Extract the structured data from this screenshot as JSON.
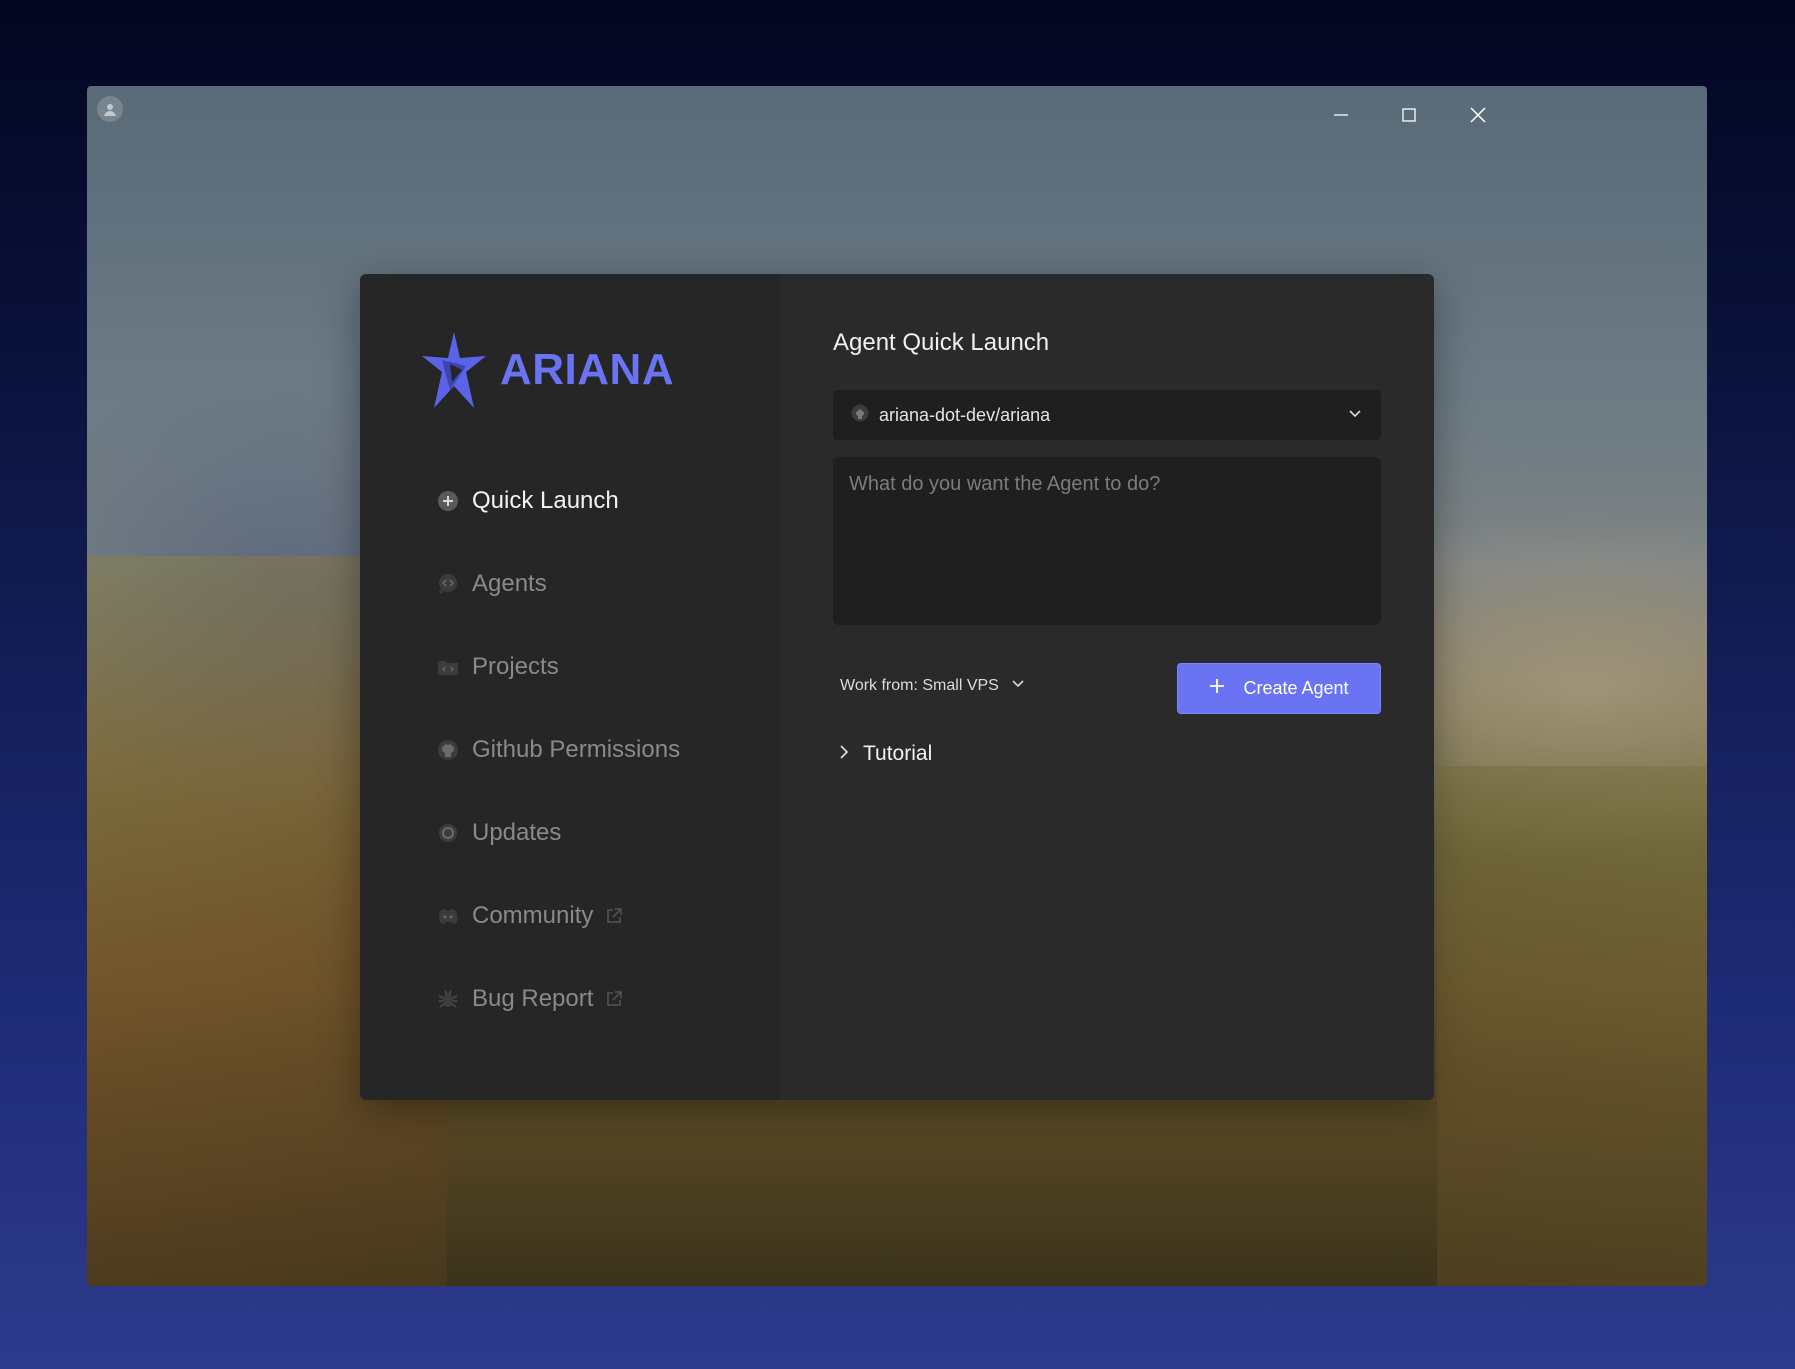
{
  "window": {
    "controls": [
      "minimize",
      "maximize",
      "close"
    ]
  },
  "brand": {
    "name": "ARIANA",
    "color": "#6a74f2"
  },
  "sidebar": {
    "items": [
      {
        "label": "Quick Launch",
        "icon": "plus-circle-icon",
        "active": true,
        "external": false
      },
      {
        "label": "Agents",
        "icon": "code-bubble-icon",
        "active": false,
        "external": false
      },
      {
        "label": "Projects",
        "icon": "folder-code-icon",
        "active": false,
        "external": false
      },
      {
        "label": "Github Permissions",
        "icon": "github-icon",
        "active": false,
        "external": false
      },
      {
        "label": "Updates",
        "icon": "gear-icon",
        "active": false,
        "external": false
      },
      {
        "label": "Community",
        "icon": "discord-icon",
        "active": false,
        "external": true
      },
      {
        "label": "Bug Report",
        "icon": "bug-icon",
        "active": false,
        "external": true
      }
    ]
  },
  "main": {
    "title": "Agent Quick Launch",
    "repo": {
      "value": "ariana-dot-dev/ariana",
      "icon": "github-icon"
    },
    "prompt": {
      "placeholder": "What do you want the Agent to do?",
      "value": ""
    },
    "work_from": {
      "label": "Work from: Small VPS"
    },
    "create_button": {
      "label": "Create Agent"
    },
    "tutorial": {
      "label": "Tutorial",
      "expanded": false
    }
  }
}
